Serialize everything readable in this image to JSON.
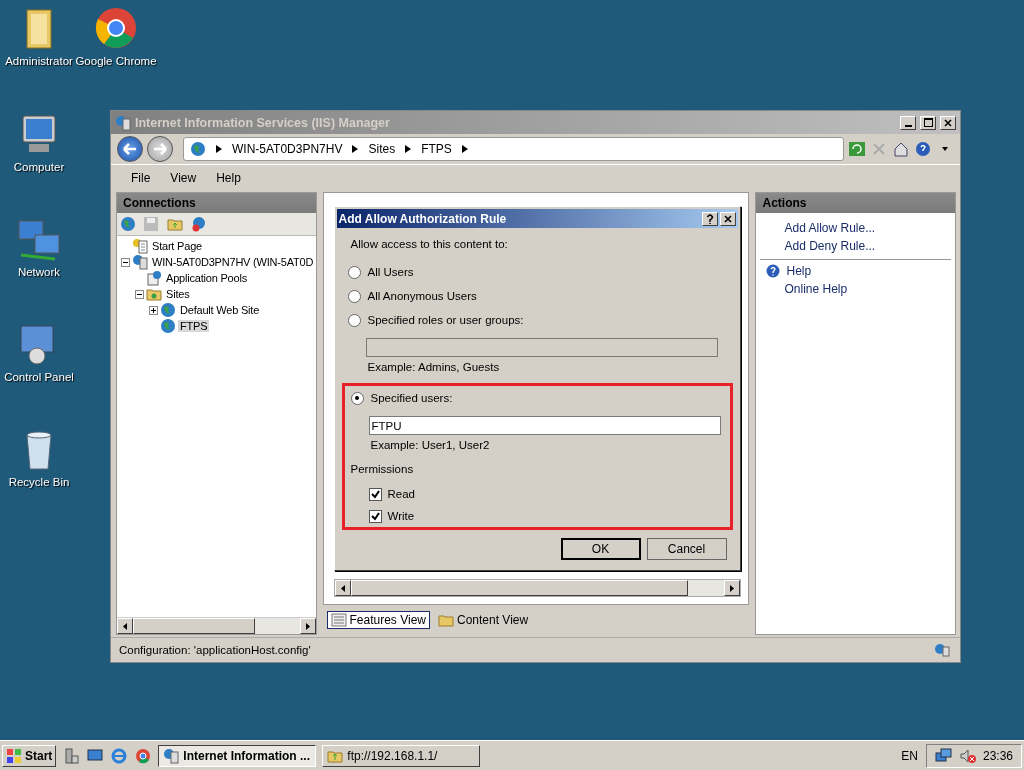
{
  "desktop_icons": [
    {
      "label": "Administrator",
      "kind": "folder"
    },
    {
      "label": "Google Chrome",
      "kind": "browser"
    },
    {
      "label": "Computer",
      "kind": "computer"
    },
    {
      "label": "Network",
      "kind": "network"
    },
    {
      "label": "Control Panel",
      "kind": "panel"
    },
    {
      "label": "Recycle Bin",
      "kind": "bin"
    }
  ],
  "window": {
    "title": "Internet Information Services (IIS) Manager",
    "active": false,
    "breadcrumb": [
      "WIN-5AT0D3PN7HV",
      "Sites",
      "FTPS"
    ],
    "menu": [
      "File",
      "View",
      "Help"
    ],
    "connections": {
      "title": "Connections",
      "tree": [
        {
          "label": "Start Page",
          "kind": "start",
          "selected": false
        },
        {
          "label": "WIN-5AT0D3PN7HV (WIN-5AT0D",
          "kind": "server",
          "selected": false,
          "expanded": true,
          "children": [
            {
              "label": "Application Pools",
              "kind": "pools",
              "selected": false
            },
            {
              "label": "Sites",
              "kind": "folder",
              "selected": false,
              "expanded": true,
              "children": [
                {
                  "label": "Default Web Site",
                  "kind": "site",
                  "selected": false,
                  "expanded": false
                },
                {
                  "label": "FTPS",
                  "kind": "site",
                  "selected": true
                }
              ]
            }
          ]
        }
      ]
    },
    "views": [
      {
        "label": "Features View",
        "selected": true
      },
      {
        "label": "Content View",
        "selected": false
      }
    ],
    "actions": {
      "title": "Actions",
      "groups": [
        [
          {
            "label": "Add Allow Rule...",
            "kind": "link"
          },
          {
            "label": "Add Deny Rule...",
            "kind": "link"
          }
        ],
        [
          {
            "label": "Help",
            "kind": "help"
          },
          {
            "label": "Online Help",
            "kind": "link"
          }
        ]
      ]
    },
    "status_bar": "Configuration: 'applicationHost.config'"
  },
  "dialog": {
    "title": "Add Allow Authorization Rule",
    "prompt": "Allow access to this content to:",
    "options": [
      {
        "label": "All Users",
        "selected": false
      },
      {
        "label": "All Anonymous Users",
        "selected": false
      },
      {
        "label": "Specified roles or user groups:",
        "selected": false,
        "field": {
          "disabled": true,
          "example": "Example: Admins, Guests"
        }
      },
      {
        "label": "Specified users:",
        "selected": true,
        "field": {
          "disabled": false,
          "value": "FTPU",
          "example": "Example: User1, User2"
        }
      }
    ],
    "permissions": {
      "title": "Permissions",
      "items": [
        {
          "label": "Read",
          "checked": true
        },
        {
          "label": "Write",
          "checked": true
        }
      ]
    },
    "highlight": true,
    "buttons": [
      {
        "label": "OK",
        "default": true
      },
      {
        "label": "Cancel",
        "default": false
      }
    ]
  },
  "taskbar": {
    "start": "Start",
    "tasks": [
      {
        "label": "Internet Information ...",
        "kind": "iis",
        "selected": true
      },
      {
        "label": "ftp://192.168.1.1/",
        "kind": "folder",
        "selected": false
      }
    ],
    "language": "EN",
    "clock": "23:36"
  }
}
